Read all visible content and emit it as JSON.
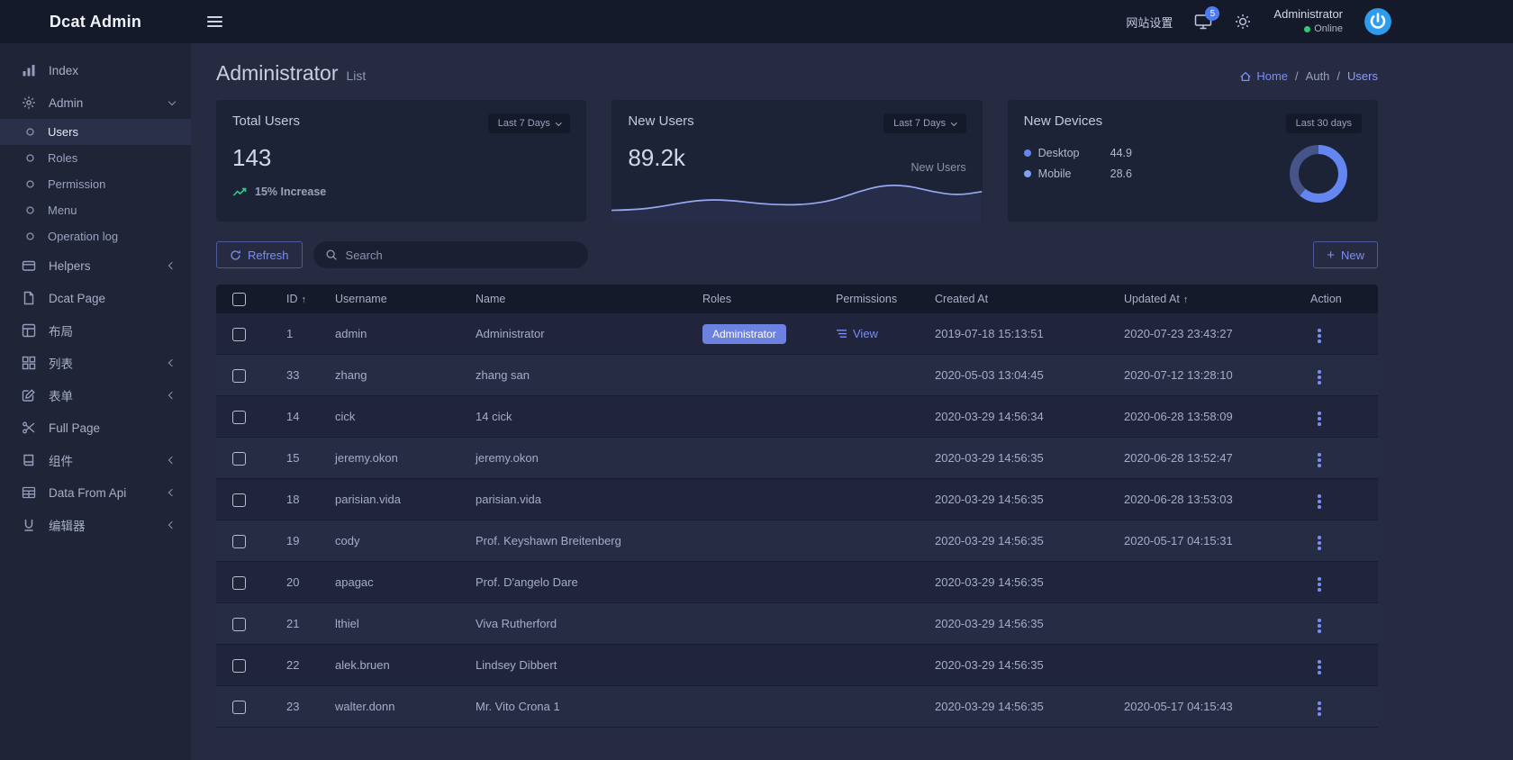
{
  "app": {
    "title": "Dcat Admin"
  },
  "topbar": {
    "site_settings_label": "网站设置",
    "notification_count": "5",
    "user": {
      "name": "Administrator",
      "status": "Online"
    }
  },
  "sidebar": {
    "items": [
      {
        "key": "index",
        "label": "Index",
        "icon": "bar-chart-icon"
      },
      {
        "key": "admin",
        "label": "Admin",
        "icon": "gear-icon",
        "expanded": true,
        "children": [
          {
            "key": "users",
            "label": "Users",
            "active": true
          },
          {
            "key": "roles",
            "label": "Roles"
          },
          {
            "key": "permission",
            "label": "Permission"
          },
          {
            "key": "menu",
            "label": "Menu"
          },
          {
            "key": "operation-log",
            "label": "Operation log"
          }
        ]
      },
      {
        "key": "helpers",
        "label": "Helpers",
        "icon": "card-icon",
        "collapsible": true
      },
      {
        "key": "dcat-page",
        "label": "Dcat Page",
        "icon": "file-icon"
      },
      {
        "key": "layout",
        "label": "布局",
        "icon": "layout-icon"
      },
      {
        "key": "list",
        "label": "列表",
        "icon": "grid-icon",
        "collapsible": true
      },
      {
        "key": "form",
        "label": "表单",
        "icon": "edit-icon",
        "collapsible": true
      },
      {
        "key": "full-page",
        "label": "Full Page",
        "icon": "scissors-icon"
      },
      {
        "key": "components",
        "label": "组件",
        "icon": "book-icon",
        "collapsible": true
      },
      {
        "key": "data-from-api",
        "label": "Data From Api",
        "icon": "table-icon",
        "collapsible": true
      },
      {
        "key": "editor",
        "label": "编辑器",
        "icon": "underline-icon",
        "collapsible": true
      }
    ]
  },
  "page": {
    "title": "Administrator",
    "subtitle": "List",
    "breadcrumb": [
      {
        "label": "Home",
        "icon": "home-icon",
        "link": true
      },
      {
        "label": "Auth"
      },
      {
        "label": "Users",
        "current": true
      }
    ]
  },
  "cards": {
    "total_users": {
      "title": "Total Users",
      "period": "Last 7 Days",
      "value": "143",
      "trend_label": "15% Increase"
    },
    "new_users": {
      "title": "New Users",
      "period": "Last 7 Days",
      "value": "89.2k",
      "series_label": "New Users"
    },
    "new_devices": {
      "title": "New Devices",
      "period": "Last 30 days",
      "legend": [
        {
          "label": "Desktop",
          "value": "44.9",
          "color": "#6386f0"
        },
        {
          "label": "Mobile",
          "value": "28.6",
          "color": "#7ea1f2"
        }
      ]
    }
  },
  "chart_data": [
    {
      "type": "area",
      "title": "New Users trend sparkline (axes unlabeled)",
      "series": [
        {
          "name": "New Users",
          "values": [
            13,
            14,
            19,
            27,
            31,
            29,
            24,
            22,
            23,
            30,
            44,
            55,
            54,
            44,
            38,
            44
          ]
        }
      ],
      "ylim": [
        0,
        70
      ],
      "grid": false,
      "legend_position": "none",
      "line_color": "#97a7f2"
    },
    {
      "type": "pie",
      "donut": true,
      "title": "New Devices",
      "labels": [
        "Desktop",
        "Mobile"
      ],
      "values": [
        44.9,
        28.6
      ],
      "colors": [
        "#6386f0",
        "#46548a"
      ],
      "legend_position": "left"
    }
  ],
  "toolbar": {
    "refresh_label": "Refresh",
    "search_placeholder": "Search",
    "new_label": "New"
  },
  "table": {
    "headers": [
      "ID",
      "Username",
      "Name",
      "Roles",
      "Permissions",
      "Created At",
      "Updated At",
      "Action"
    ],
    "sorted": [
      "ID",
      "Updated At"
    ],
    "rows": [
      {
        "id": "1",
        "username": "admin",
        "name": "Administrator",
        "role_badge": "Administrator",
        "permission_link": "View",
        "created_at": "2019-07-18 15:13:51",
        "updated_at": "2020-07-23 23:43:27"
      },
      {
        "id": "33",
        "username": "zhang",
        "name": "zhang san",
        "created_at": "2020-05-03 13:04:45",
        "updated_at": "2020-07-12 13:28:10"
      },
      {
        "id": "14",
        "username": "cick",
        "name": "14 cick",
        "created_at": "2020-03-29 14:56:34",
        "updated_at": "2020-06-28 13:58:09"
      },
      {
        "id": "15",
        "username": "jeremy.okon",
        "name": "jeremy.okon",
        "created_at": "2020-03-29 14:56:35",
        "updated_at": "2020-06-28 13:52:47"
      },
      {
        "id": "18",
        "username": "parisian.vida",
        "name": "parisian.vida",
        "created_at": "2020-03-29 14:56:35",
        "updated_at": "2020-06-28 13:53:03"
      },
      {
        "id": "19",
        "username": "cody",
        "name": "Prof. Keyshawn Breitenberg",
        "created_at": "2020-03-29 14:56:35",
        "updated_at": "2020-05-17 04:15:31"
      },
      {
        "id": "20",
        "username": "apagac",
        "name": "Prof. D'angelo Dare",
        "created_at": "2020-03-29 14:56:35",
        "updated_at": ""
      },
      {
        "id": "21",
        "username": "lthiel",
        "name": "Viva Rutherford",
        "created_at": "2020-03-29 14:56:35",
        "updated_at": ""
      },
      {
        "id": "22",
        "username": "alek.bruen",
        "name": "Lindsey Dibbert",
        "created_at": "2020-03-29 14:56:35",
        "updated_at": ""
      },
      {
        "id": "23",
        "username": "walter.donn",
        "name": "Mr. Vito Crona 1",
        "created_at": "2020-03-29 14:56:35",
        "updated_at": "2020-05-17 04:15:43"
      }
    ]
  }
}
